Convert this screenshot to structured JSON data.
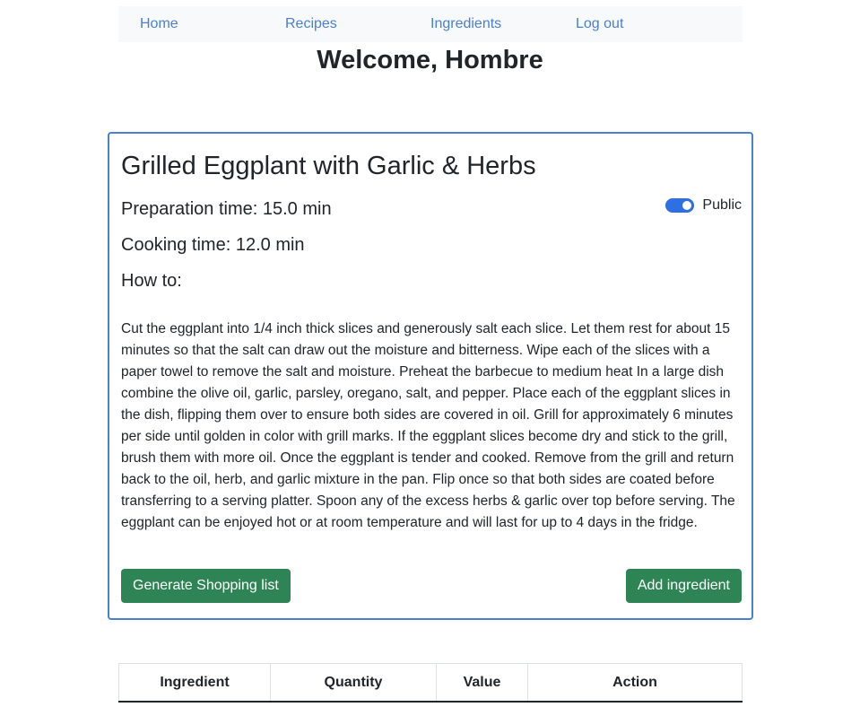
{
  "nav": {
    "links": [
      "Home",
      "Recipes",
      "Ingredients",
      "Log out"
    ]
  },
  "welcome": "Welcome, Hombre",
  "recipe": {
    "title": "Grilled Eggplant with Garlic & Herbs",
    "prep": "Preparation time: 15.0 min",
    "cook": "Cooking time: 12.0 min",
    "how_to": "How to:",
    "visibility_label": "Public",
    "visibility_on": true,
    "instructions": "Cut the eggplant into 1/4 inch thick slices and generously salt each slice. Let them rest for about 15 minutes so that the salt can draw out the moisture and bitterness. Wipe each of the slices with a paper towel to remove the salt and moisture. Preheat the barbecue to medium heat In a large dish combine the olive oil, garlic, parsley, oregano, salt, and pepper. Place each of the eggplant slices in the dish, flipping them over to ensure both sides are covered in oil. Grill for approximately 6 minutes per side until golden in color with grill marks. If the eggplant slices become dry and stick to the grill, brush them with more oil. Once the eggplant is tender and cooked. Remove from the grill and return back to the oil, herb, and garlic mixture in the pan. Flip once so that both sides are coated before transferring to a serving platter. Spoon any of the excess herbs & garlic over top before serving. The eggplant can be enjoyed hot or at room temperature and will last for up to 4 days in the fridge.",
    "shopping_button": "Generate Shopping list",
    "add_ingredient_button": "Add ingredient"
  },
  "table": {
    "headers": [
      "Ingredient",
      "Quantity",
      "Value",
      "Action"
    ]
  },
  "colors": {
    "link": "#4a7fd1",
    "card_border": "#4a7fd1",
    "button": "#2f8455",
    "toggle": "#2f6fe4"
  }
}
